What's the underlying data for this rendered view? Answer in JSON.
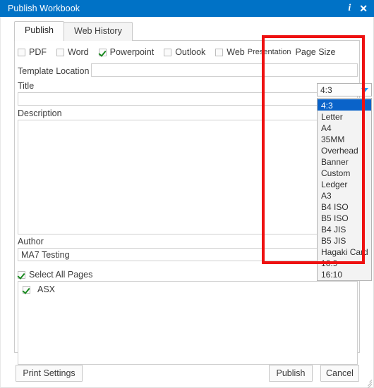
{
  "window": {
    "title": "Publish Workbook",
    "info_icon": "info-icon-glyph",
    "close_icon": "close-icon-glyph",
    "titlebar_color": "#0072c6"
  },
  "tabs": [
    {
      "label": "Publish",
      "active": true
    },
    {
      "label": "Web History",
      "active": false
    }
  ],
  "formats": [
    {
      "label": "PDF",
      "checked": false
    },
    {
      "label": "Word",
      "checked": false
    },
    {
      "label": "Powerpoint",
      "checked": true
    },
    {
      "label": "Outlook",
      "checked": false
    },
    {
      "label": "Web",
      "checked": false
    }
  ],
  "presentation_label": "Presentation",
  "page_size": {
    "label": "Page Size",
    "value": "4:3",
    "expanded": true,
    "highlight_color": "#0a63c9",
    "arrow_color": "#2196f3",
    "options": [
      "4:3",
      "Letter",
      "A4",
      "35MM",
      "Overhead",
      "Banner",
      "Custom",
      "Ledger",
      "A3",
      "B4 ISO",
      "B5 ISO",
      "B4 JIS",
      "B5 JIS",
      "Hagaki Card",
      "16:9",
      "16:10"
    ]
  },
  "fields": {
    "template_location": {
      "label": "Template Location",
      "value": "",
      "placeholder": ""
    },
    "title": {
      "label": "Title",
      "value": "",
      "placeholder": ""
    },
    "description": {
      "label": "Description",
      "value": "",
      "placeholder": ""
    },
    "author": {
      "label": "Author",
      "value": "MA7 Testing",
      "placeholder": ""
    }
  },
  "select_all_pages": {
    "label": "Select All Pages",
    "checked": true
  },
  "pages": [
    {
      "label": "ASX",
      "checked": true
    }
  ],
  "buttons": {
    "print_settings": "Print Settings",
    "publish": "Publish",
    "cancel": "Cancel"
  },
  "annotation": {
    "color": "#ee1111"
  }
}
